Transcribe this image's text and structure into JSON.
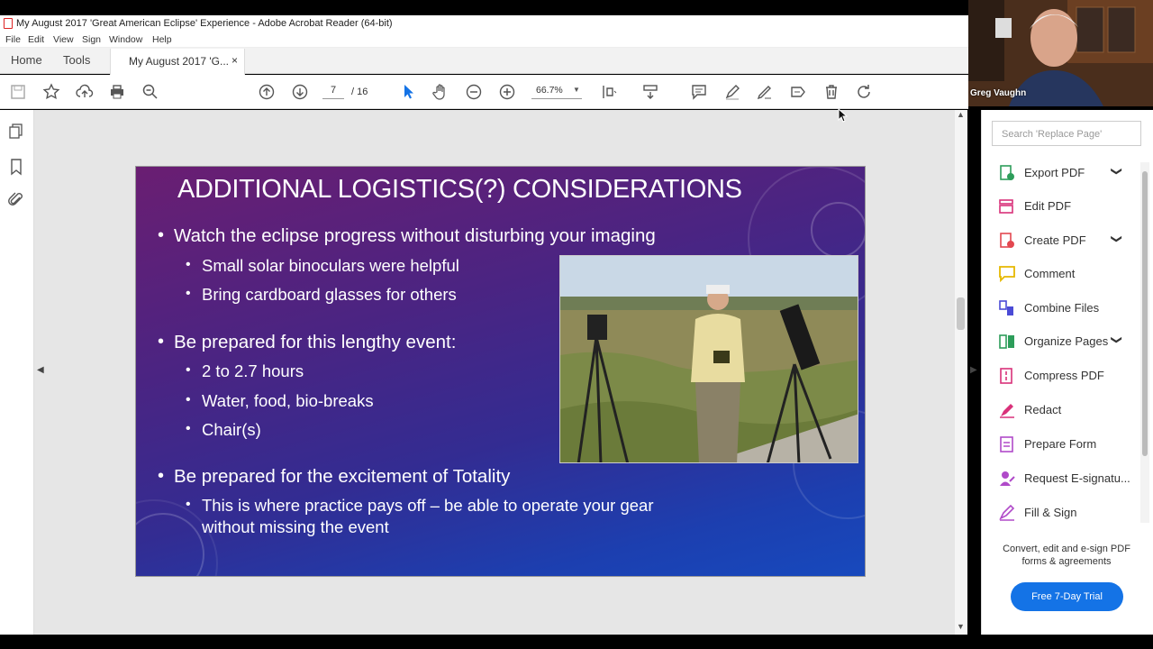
{
  "window": {
    "title": "My August 2017  'Great American Eclipse' Experience - Adobe Acrobat Reader (64-bit)"
  },
  "menu": [
    "File",
    "Edit",
    "View",
    "Sign",
    "Window",
    "Help"
  ],
  "tabs": {
    "home": "Home",
    "tools": "Tools",
    "document": "My August 2017  'G...",
    "close": "×"
  },
  "toolbar": {
    "page_current": "7",
    "page_total": "/  16",
    "zoom": "66.7%"
  },
  "slide": {
    "title": "ADDITIONAL LOGISTICS(?) CONSIDERATIONS",
    "bullets": [
      {
        "text": "Watch the eclipse progress without disturbing your imaging",
        "subs": [
          "Small solar binoculars were helpful",
          "Bring cardboard glasses for others"
        ]
      },
      {
        "text": "Be prepared for this lengthy event:",
        "subs": [
          "2 to 2.7 hours",
          "Water, food, bio-breaks",
          "Chair(s)"
        ]
      },
      {
        "text": "Be prepared for the excitement of Totality",
        "subs": [
          "This is where practice pays off – be able to operate your gear",
          "without missing the event"
        ]
      }
    ]
  },
  "right_panel": {
    "search_placeholder": "Search 'Replace Page'",
    "tools": [
      {
        "label": "Export PDF",
        "icon": "export-pdf-icon",
        "color": "#2d9d5a"
      },
      {
        "label": "Edit PDF",
        "icon": "edit-pdf-icon",
        "color": "#d9317a"
      },
      {
        "label": "Create PDF",
        "icon": "create-pdf-icon",
        "color": "#e34850"
      },
      {
        "label": "Comment",
        "icon": "comment-icon",
        "color": "#e6b800"
      },
      {
        "label": "Combine Files",
        "icon": "combine-files-icon",
        "color": "#4b4bd6"
      },
      {
        "label": "Organize Pages",
        "icon": "organize-pages-icon",
        "color": "#2d9d5a"
      },
      {
        "label": "Compress PDF",
        "icon": "compress-pdf-icon",
        "color": "#d9317a"
      },
      {
        "label": "Redact",
        "icon": "redact-icon",
        "color": "#d9317a"
      },
      {
        "label": "Prepare Form",
        "icon": "prepare-form-icon",
        "color": "#b04ac9"
      },
      {
        "label": "Request E-signatu...",
        "icon": "request-esign-icon",
        "color": "#b04ac9"
      },
      {
        "label": "Fill & Sign",
        "icon": "fill-sign-icon",
        "color": "#b04ac9"
      }
    ],
    "promo": "Convert, edit and e-sign PDF forms & agreements",
    "trial_button": "Free 7-Day Trial"
  },
  "webcam": {
    "name": "Greg Vaughn"
  }
}
